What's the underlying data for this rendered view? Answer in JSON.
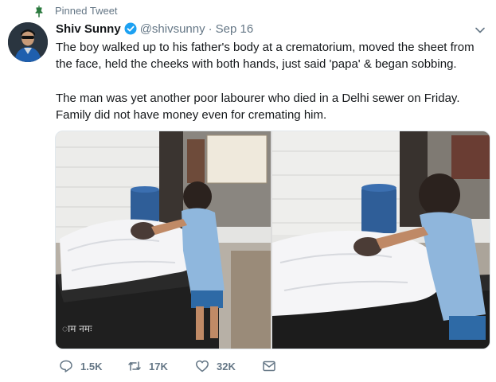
{
  "pinned": {
    "label": "Pinned Tweet",
    "icon": "pin-icon"
  },
  "author": {
    "name": "Shiv Sunny",
    "handle": "@shivsunny",
    "separator": "·",
    "date": "Sep 16",
    "verified_icon": "verified-badge-icon"
  },
  "tweet": {
    "paragraph1": "The boy walked up to his father's body at a crematorium, moved the sheet from the face, held the cheeks with both hands, just said 'papa' & began sobbing.",
    "paragraph2": "The man was yet another poor labourer who died in a Delhi sewer on Friday. Family did not have money even for cremating him."
  },
  "actions": {
    "reply": {
      "count": "1.5K",
      "icon": "reply-icon"
    },
    "retweet": {
      "count": "17K",
      "icon": "retweet-icon"
    },
    "like": {
      "count": "32K",
      "icon": "heart-icon"
    },
    "dm": {
      "icon": "envelope-icon"
    }
  },
  "colors": {
    "text": "#14171a",
    "secondary": "#657786",
    "verified": "#1da1f2",
    "pin": "#17bf63"
  }
}
